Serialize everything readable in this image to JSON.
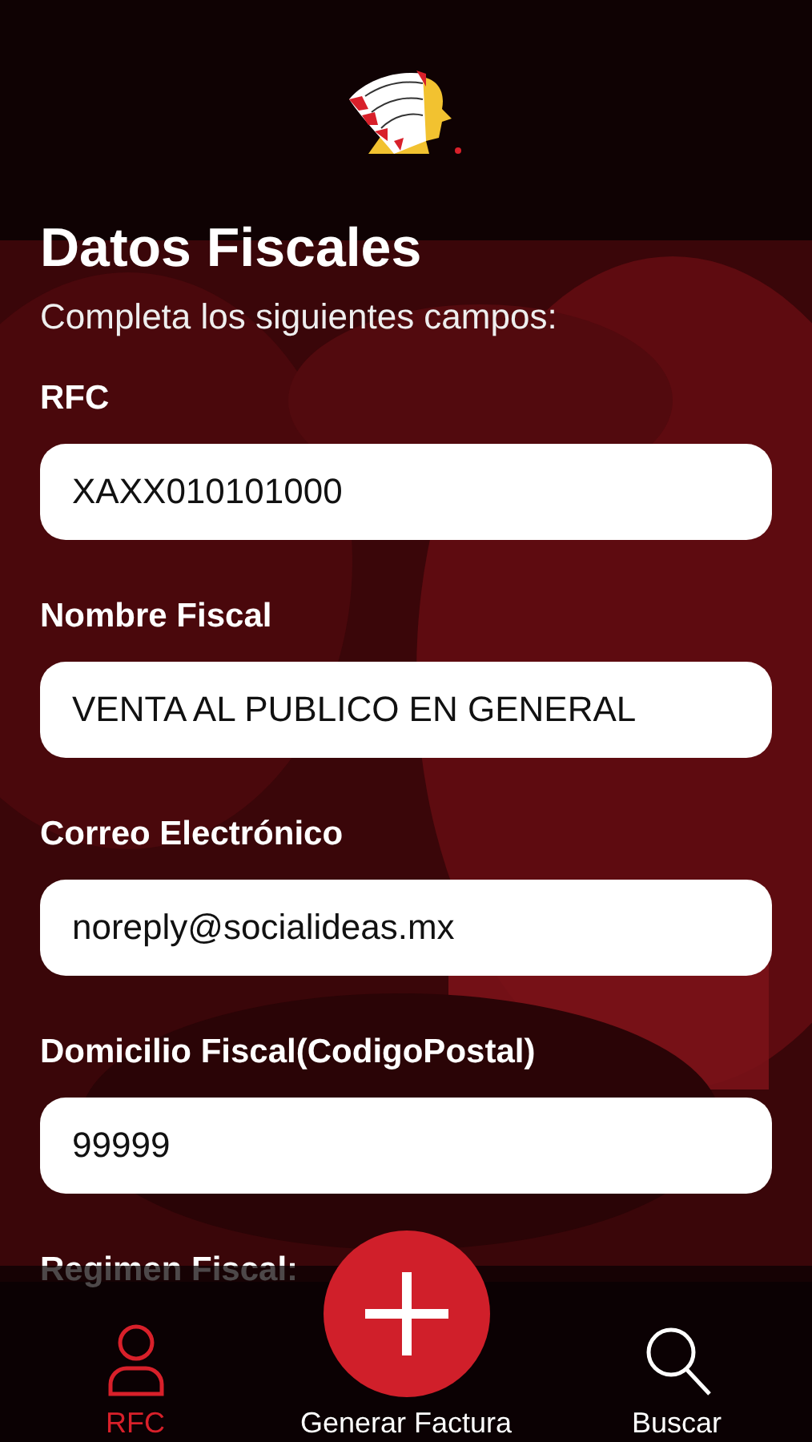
{
  "title": "Datos Fiscales",
  "subtitle": "Completa los siguientes campos:",
  "fields": [
    {
      "label": "RFC",
      "value": "XAXX010101000"
    },
    {
      "label": "Nombre Fiscal",
      "value": "VENTA AL PUBLICO EN GENERAL"
    },
    {
      "label": "Correo Electrónico",
      "value": "noreply@socialideas.mx"
    },
    {
      "label": "Domicilio Fiscal(CodigoPostal)",
      "value": "99999"
    },
    {
      "label": "Regimen Fiscal:"
    }
  ],
  "tabs": [
    {
      "kind": "profile",
      "label": "RFC",
      "selected": true
    },
    {
      "kind": "add",
      "label": "Generar Factura",
      "selected": false
    },
    {
      "kind": "search",
      "label": "Buscar",
      "selected": false
    }
  ]
}
